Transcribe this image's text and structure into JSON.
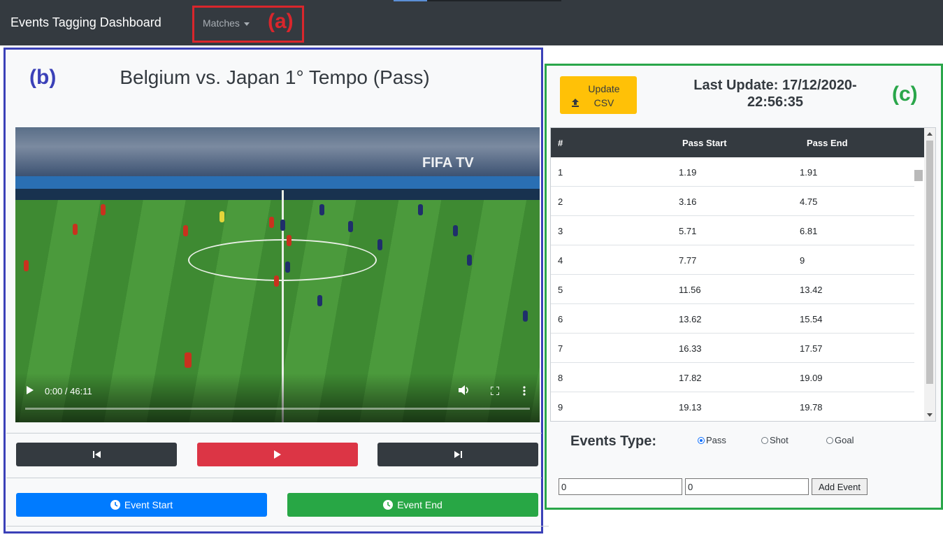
{
  "navbar": {
    "brand": "Events Tagging Dashboard",
    "dropdown_label": "Matches"
  },
  "annotations": [
    {
      "label": "(a)",
      "color": "#d9262c"
    },
    {
      "label": "(b)",
      "color": "#3b41b8"
    },
    {
      "label": "(c)",
      "color": "#2aa64a"
    }
  ],
  "video": {
    "title": "Belgium vs. Japan 1° Tempo (Pass)",
    "time": "0:00 / 46:11",
    "fifa_logo_text": "FIFA TV"
  },
  "playback": {
    "prev_icon": "skip-previous-icon",
    "play_icon": "play-icon",
    "next_icon": "skip-next-icon"
  },
  "event_buttons": {
    "start_label": "Event Start",
    "end_label": "Event End",
    "icon": "clock-icon"
  },
  "panel": {
    "update_label": "Update CSV",
    "update_icon": "upload-icon",
    "last_update_line1": "Last Update: 17/12/2020-",
    "last_update_line2": "22:56:35"
  },
  "table": {
    "headers": [
      "#",
      "Pass Start",
      "Pass End"
    ],
    "rows": [
      [
        "1",
        "1.19",
        "1.91"
      ],
      [
        "2",
        "3.16",
        "4.75"
      ],
      [
        "3",
        "5.71",
        "6.81"
      ],
      [
        "4",
        "7.77",
        "9"
      ],
      [
        "5",
        "11.56",
        "13.42"
      ],
      [
        "6",
        "13.62",
        "15.54"
      ],
      [
        "7",
        "16.33",
        "17.57"
      ],
      [
        "8",
        "17.82",
        "19.09"
      ],
      [
        "9",
        "19.13",
        "19.78"
      ]
    ]
  },
  "events_type": {
    "label": "Events Type:",
    "options": [
      "Pass",
      "Shot",
      "Goal"
    ],
    "selected": "Pass"
  },
  "inputs": {
    "start_value": "0",
    "end_value": "0",
    "add_label": "Add Event"
  },
  "colors": {
    "navbar": "#343a40",
    "danger": "#dc3545",
    "primary": "#007bff",
    "success": "#28a745",
    "warning": "#ffc107"
  }
}
